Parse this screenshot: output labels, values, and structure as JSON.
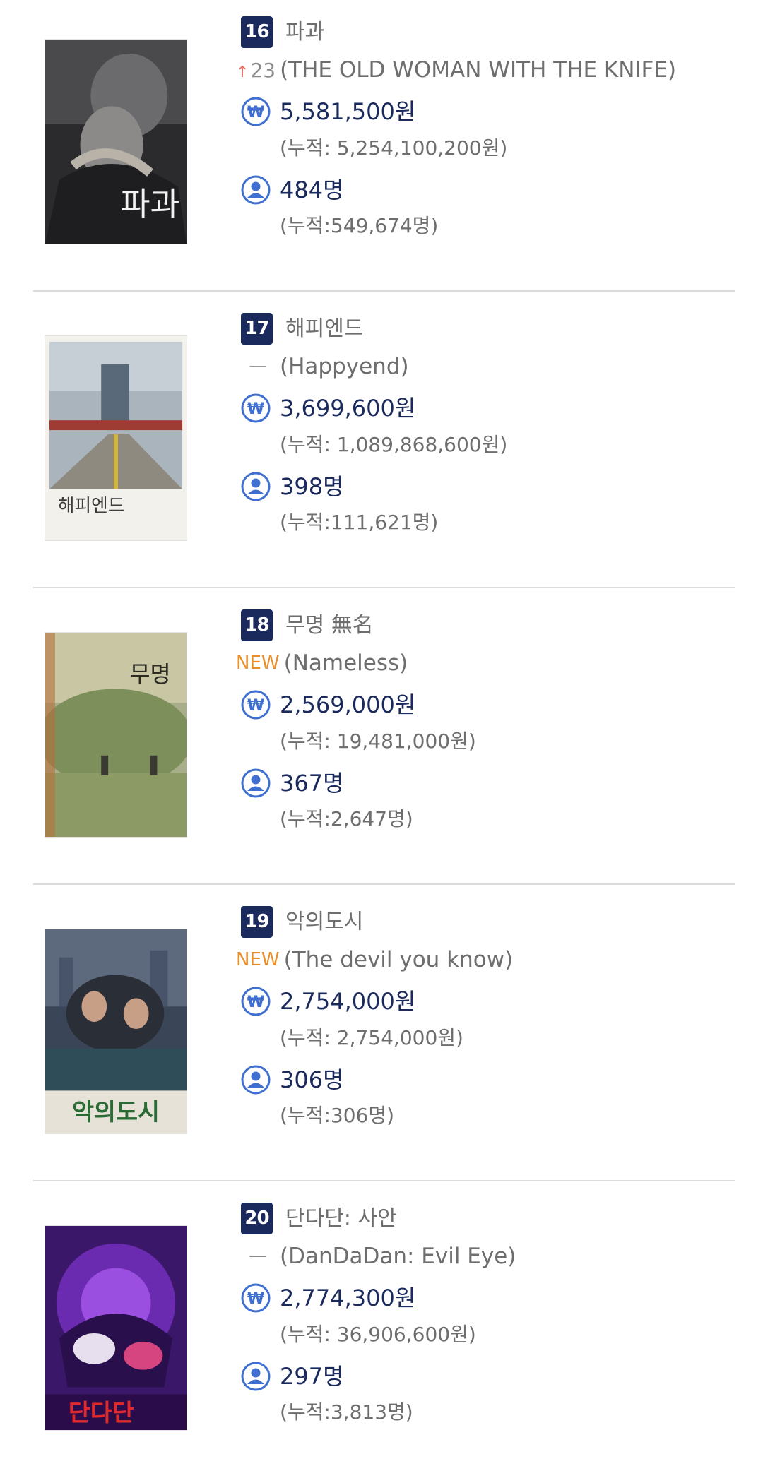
{
  "movies": [
    {
      "rank": "16",
      "title_ko": "파과",
      "change_type": "up",
      "change_value": "23",
      "title_en": "(THE OLD WOMAN WITH THE KNIFE)",
      "revenue": "5,581,500원",
      "revenue_cumulative": "(누적: 5,254,100,200원)",
      "audience": "484명",
      "audience_cumulative": "(누적:549,674명)",
      "poster_text": "파과"
    },
    {
      "rank": "17",
      "title_ko": "해피엔드",
      "change_type": "same",
      "change_value": "ㅡ",
      "title_en": "(Happyend)",
      "revenue": "3,699,600원",
      "revenue_cumulative": "(누적: 1,089,868,600원)",
      "audience": "398명",
      "audience_cumulative": "(누적:111,621명)",
      "poster_text": "해피엔드"
    },
    {
      "rank": "18",
      "title_ko": "무명 無名",
      "change_type": "new",
      "change_value": "NEW",
      "title_en": "(Nameless)",
      "revenue": "2,569,000원",
      "revenue_cumulative": "(누적: 19,481,000원)",
      "audience": "367명",
      "audience_cumulative": "(누적:2,647명)",
      "poster_text": "무명"
    },
    {
      "rank": "19",
      "title_ko": "악의도시",
      "change_type": "new",
      "change_value": "NEW",
      "title_en": "(The devil you know)",
      "revenue": "2,754,000원",
      "revenue_cumulative": "(누적: 2,754,000원)",
      "audience": "306명",
      "audience_cumulative": "(누적:306명)",
      "poster_text": "악의도시"
    },
    {
      "rank": "20",
      "title_ko": "단다단: 사안",
      "change_type": "same",
      "change_value": "ㅡ",
      "title_en": "(DanDaDan: Evil Eye)",
      "revenue": "2,774,300원",
      "revenue_cumulative": "(누적: 36,906,600원)",
      "audience": "297명",
      "audience_cumulative": "(누적:3,813명)",
      "poster_text": "단다단"
    }
  ],
  "icons": {
    "revenue": "won-coin-icon",
    "audience": "person-icon",
    "rank_up": "arrow-up-icon"
  },
  "colors": {
    "badge": "#1b2a5c",
    "value_text": "#1b2a5c",
    "icon": "#3f6fd1",
    "new_label": "#e98e2b",
    "rank_up_arrow": "#e8736b",
    "muted_text": "#6e6e6e",
    "divider": "#dcdcdc"
  }
}
